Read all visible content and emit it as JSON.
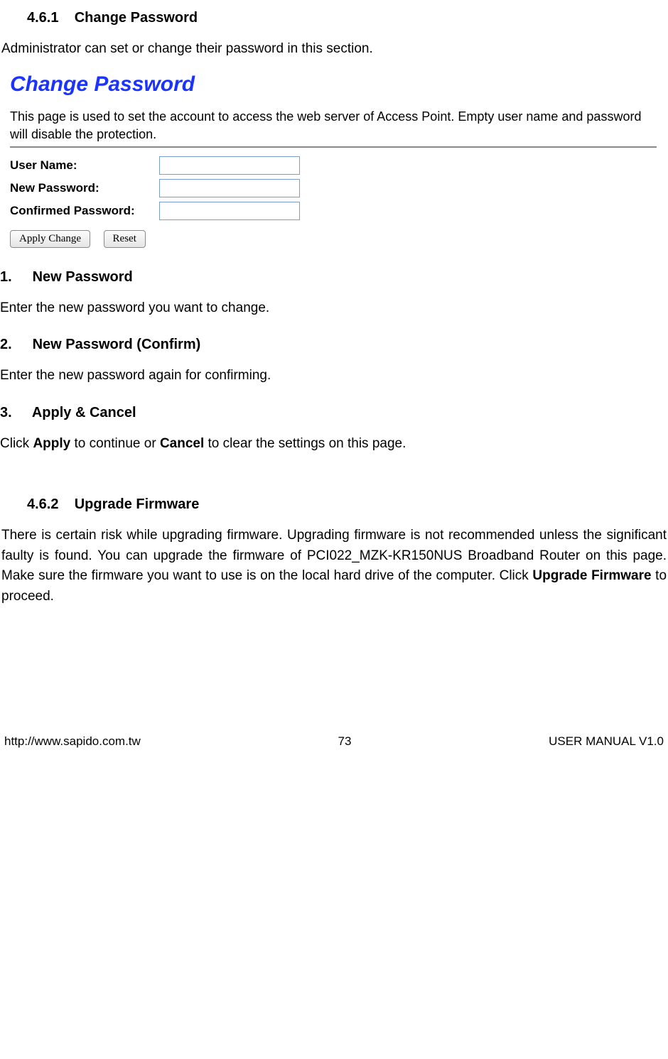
{
  "section1": {
    "number": "4.6.1",
    "title": "Change Password",
    "intro": "Administrator can set or change their password in this section."
  },
  "screenshot": {
    "title": "Change Password",
    "description": "This page is used to set the account to access the web server of Access Point. Empty user name and password will disable the protection.",
    "labels": {
      "username": "User Name:",
      "newpass": "New Password:",
      "confirm": "Confirmed Password:"
    },
    "buttons": {
      "apply": "Apply Change",
      "reset": "Reset"
    }
  },
  "items": {
    "i1": {
      "n": "1.",
      "h": "New Password",
      "t": "Enter the new password you want to change."
    },
    "i2": {
      "n": "2.",
      "h": "New Password (Confirm)",
      "t": "Enter the new password again for confirming."
    },
    "i3": {
      "n": "3.",
      "h": "Apply & Cancel",
      "pre": "Click ",
      "b1": "Apply",
      "mid": " to continue or ",
      "b2": "Cancel",
      "post": " to clear the settings on this page."
    }
  },
  "section2": {
    "number": "4.6.2",
    "title": "Upgrade Firmware",
    "para_pre": "There is certain risk while upgrading firmware. Upgrading firmware is not recommended unless the significant faulty is found. You can upgrade the firmware of PCI022_MZK-KR150NUS Broadband Router on this page. Make sure the firmware you want to use is on the local hard drive of the computer. Click ",
    "para_bold": "Upgrade Firmware",
    "para_post": " to proceed."
  },
  "footer": {
    "left": "http://www.sapido.com.tw",
    "center": "73",
    "right": "USER MANUAL V1.0"
  }
}
